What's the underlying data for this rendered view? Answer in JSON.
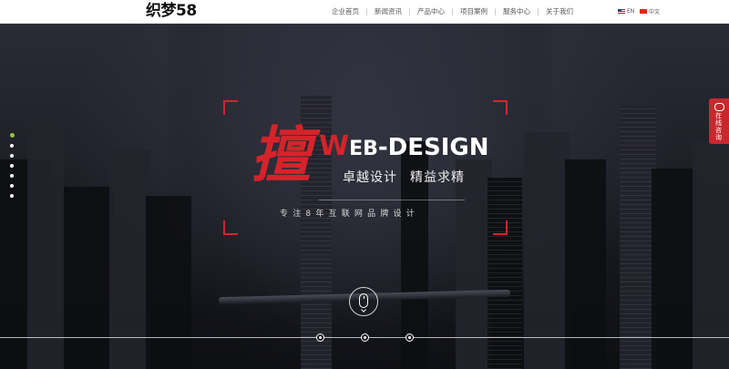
{
  "header": {
    "logo": "织梦58",
    "nav": [
      "企业首页",
      "新闻资讯",
      "产品中心",
      "项目案例",
      "服务中心",
      "关于我们"
    ],
    "lang_en": "EN",
    "lang_cn": "中文"
  },
  "hero": {
    "big_char": "擅",
    "headline_w": "W",
    "headline_eb": "EB",
    "headline_rest": "-DESIGN",
    "slogan_a": "卓越设计",
    "slogan_b": "精益求精",
    "subtitle": "专注8年互联网品牌设计"
  },
  "side_consult": "在线咨询",
  "colors": {
    "accent": "#d4242a",
    "active_dot": "#8dc63f",
    "header_bg": "#ffffff"
  }
}
